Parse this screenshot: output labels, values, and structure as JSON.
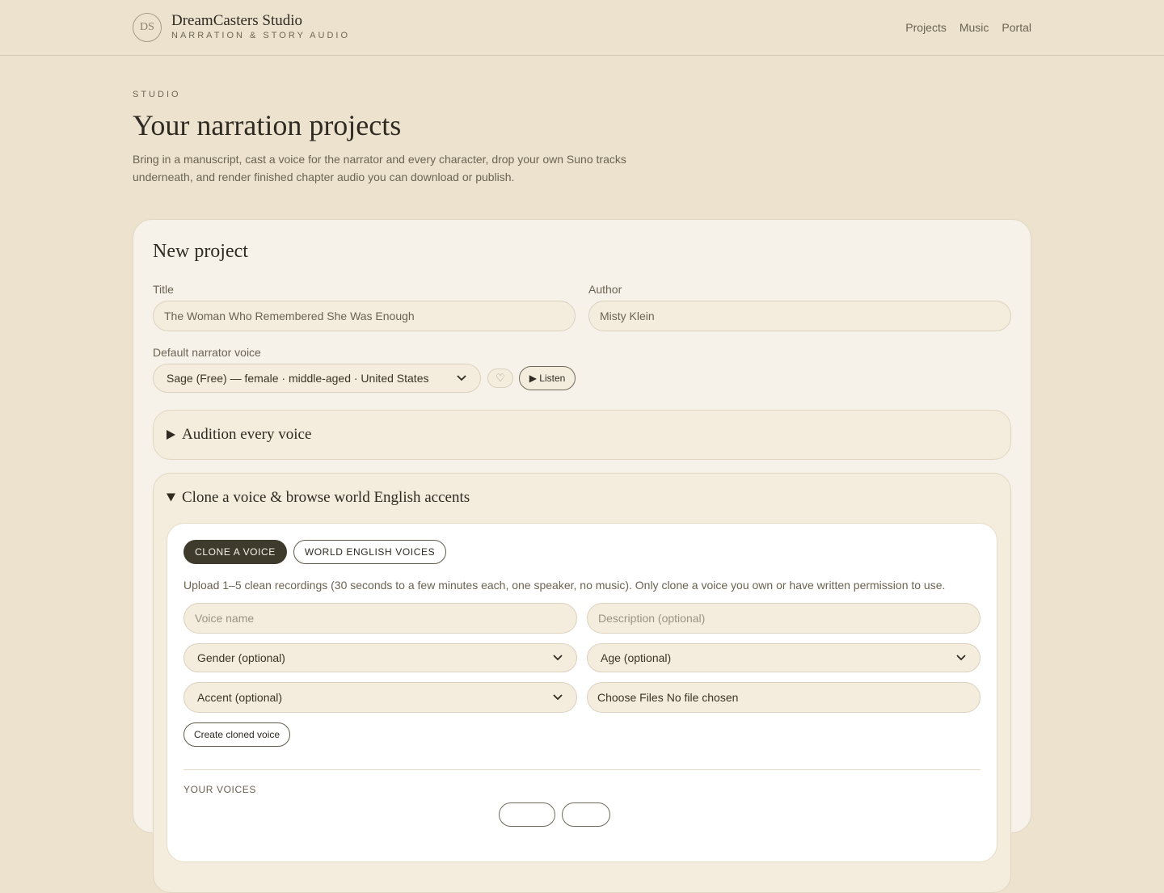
{
  "header": {
    "logo_initials": "DS",
    "brand_name": "DreamCasters Studio",
    "brand_tagline": "NARRATION & STORY AUDIO",
    "nav": [
      "Projects",
      "Music",
      "Portal"
    ]
  },
  "intro": {
    "eyebrow": "STUDIO",
    "title": "Your narration projects",
    "description": "Bring in a manuscript, cast a voice for the narrator and every character, drop your own Suno tracks underneath, and render finished chapter audio you can download or publish."
  },
  "new_project": {
    "heading": "New project",
    "title_label": "Title",
    "title_value": "The Woman Who Remembered She Was Enough",
    "author_label": "Author",
    "author_value": "Misty Klein",
    "narrator_label": "Default narrator voice",
    "narrator_selected": "Sage (Free) — female · middle-aged · United States",
    "favorite_icon": "♡",
    "listen_label": "▶ Listen"
  },
  "audition": {
    "heading": "Audition every voice",
    "expanded": false
  },
  "clone": {
    "heading": "Clone a voice & browse world English accents",
    "expanded": true,
    "tabs": [
      {
        "label": "CLONE A VOICE",
        "active": true
      },
      {
        "label": "WORLD ENGLISH VOICES",
        "active": false
      }
    ],
    "hint": "Upload 1–5 clean recordings (30 seconds to a few minutes each, one speaker, no music). Only clone a voice you own or have written permission to use.",
    "voice_name_placeholder": "Voice name",
    "description_placeholder": "Description (optional)",
    "gender_selected": "Gender (optional)",
    "age_selected": "Age (optional)",
    "accent_selected": "Accent (optional)",
    "file_button": "Choose Files",
    "file_status": "No file chosen",
    "create_label": "Create cloned voice",
    "your_voices_label": "YOUR VOICES"
  },
  "colors": {
    "background": "#ece2ce",
    "card": "#f6f2ea",
    "accent_dark": "#3f3b2c"
  }
}
